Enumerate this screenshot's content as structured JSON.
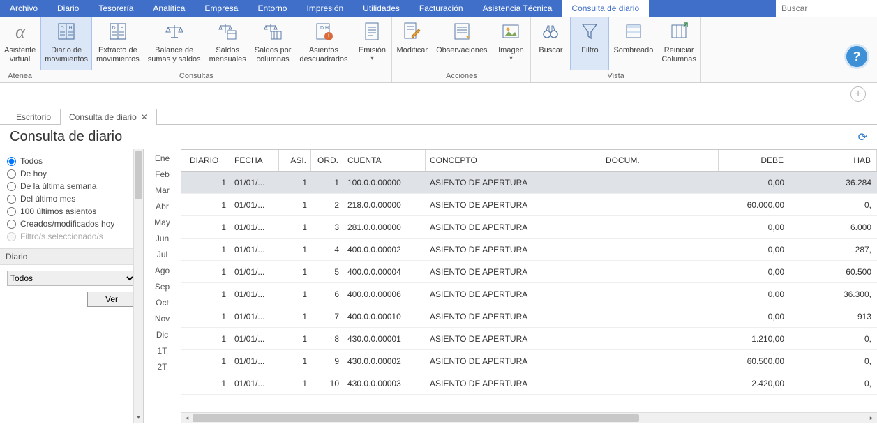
{
  "menu": [
    "Archivo",
    "Diario",
    "Tesorería",
    "Analítica",
    "Empresa",
    "Entorno",
    "Impresión",
    "Utilidades",
    "Facturación",
    "Asistencia Técnica",
    "Consulta de diario"
  ],
  "menu_active_index": 10,
  "search_placeholder": "Buscar",
  "ribbon_groups": [
    {
      "label": "Atenea",
      "buttons": [
        {
          "name": "asistente-virtual",
          "l1": "Asistente",
          "l2": "virtual",
          "icon": "alpha"
        }
      ]
    },
    {
      "label": "Consultas",
      "buttons": [
        {
          "name": "diario-movimientos",
          "l1": "Diario de",
          "l2": "movimientos",
          "icon": "doc-dh",
          "active": true
        },
        {
          "name": "extracto-movimientos",
          "l1": "Extracto de",
          "l2": "movimientos",
          "icon": "doc-dh"
        },
        {
          "name": "balance-sumas-saldos",
          "l1": "Balance de",
          "l2": "sumas y saldos",
          "icon": "scales"
        },
        {
          "name": "saldos-mensuales",
          "l1": "Saldos",
          "l2": "mensuales",
          "icon": "scales-cal"
        },
        {
          "name": "saldos-por-columnas",
          "l1": "Saldos por",
          "l2": "columnas",
          "icon": "scales-cols"
        },
        {
          "name": "asientos-descuadrados",
          "l1": "Asientos",
          "l2": "descuadrados",
          "icon": "doc-warn"
        }
      ]
    },
    {
      "label": "",
      "buttons": [
        {
          "name": "emision",
          "l1": "Emisión",
          "l2": "",
          "icon": "doc",
          "dropdown": true
        }
      ]
    },
    {
      "label": "Acciones",
      "buttons": [
        {
          "name": "modificar",
          "l1": "Modificar",
          "l2": "",
          "icon": "edit"
        },
        {
          "name": "observaciones",
          "l1": "Observaciones",
          "l2": "",
          "icon": "note"
        },
        {
          "name": "imagen",
          "l1": "Imagen",
          "l2": "",
          "icon": "image",
          "dropdown": true
        }
      ]
    },
    {
      "label": "Vista",
      "buttons": [
        {
          "name": "buscar",
          "l1": "Buscar",
          "l2": "",
          "icon": "binoc"
        },
        {
          "name": "filtro",
          "l1": "Filtro",
          "l2": "",
          "icon": "funnel",
          "active": true
        },
        {
          "name": "sombreado",
          "l1": "Sombreado",
          "l2": "",
          "icon": "shade"
        },
        {
          "name": "reiniciar-columnas",
          "l1": "Reiniciar",
          "l2": "Columnas",
          "icon": "columns"
        }
      ]
    }
  ],
  "tabs": [
    {
      "name": "escritorio",
      "label": "Escritorio",
      "active": false,
      "closable": false
    },
    {
      "name": "consulta-diario",
      "label": "Consulta de diario",
      "active": true,
      "closable": true
    }
  ],
  "page_title": "Consulta de diario",
  "filters": {
    "radios": [
      {
        "id": "todos",
        "label": "Todos",
        "checked": true
      },
      {
        "id": "de-hoy",
        "label": "De hoy"
      },
      {
        "id": "ultima-semana",
        "label": "De la última semana"
      },
      {
        "id": "ultimo-mes",
        "label": "Del último mes"
      },
      {
        "id": "cien-ultimos",
        "label": "100 últimos asientos"
      },
      {
        "id": "creados-hoy",
        "label": "Creados/modificados hoy"
      },
      {
        "id": "filtros-sel",
        "label": "Filtro/s seleccionado/s",
        "disabled": true
      }
    ],
    "section_label": "Diario",
    "combo_value": "Todos",
    "ver_label": "Ver"
  },
  "months": [
    "Ene",
    "Feb",
    "Mar",
    "Abr",
    "May",
    "Jun",
    "Jul",
    "Ago",
    "Sep",
    "Oct",
    "Nov",
    "Dic",
    "1T",
    "2T"
  ],
  "columns": [
    {
      "key": "diario",
      "label": "DIARIO"
    },
    {
      "key": "fecha",
      "label": "FECHA"
    },
    {
      "key": "asi",
      "label": "ASI."
    },
    {
      "key": "ord",
      "label": "ORD."
    },
    {
      "key": "cuenta",
      "label": "CUENTA"
    },
    {
      "key": "concepto",
      "label": "CONCEPTO"
    },
    {
      "key": "docum",
      "label": "DOCUM."
    },
    {
      "key": "debe",
      "label": "DEBE"
    },
    {
      "key": "hab",
      "label": "HAB"
    }
  ],
  "rows": [
    {
      "diario": "1",
      "fecha": "01/01/...",
      "asi": "1",
      "ord": "1",
      "cuenta": "100.0.0.00000",
      "concepto": "ASIENTO DE APERTURA",
      "docum": "",
      "debe": "0,00",
      "hab": "36.284",
      "sel": true
    },
    {
      "diario": "1",
      "fecha": "01/01/...",
      "asi": "1",
      "ord": "2",
      "cuenta": "218.0.0.00000",
      "concepto": "ASIENTO DE APERTURA",
      "docum": "",
      "debe": "60.000,00",
      "hab": "0,"
    },
    {
      "diario": "1",
      "fecha": "01/01/...",
      "asi": "1",
      "ord": "3",
      "cuenta": "281.0.0.00000",
      "concepto": "ASIENTO DE APERTURA",
      "docum": "",
      "debe": "0,00",
      "hab": "6.000"
    },
    {
      "diario": "1",
      "fecha": "01/01/...",
      "asi": "1",
      "ord": "4",
      "cuenta": "400.0.0.00002",
      "concepto": "ASIENTO DE APERTURA",
      "docum": "",
      "debe": "0,00",
      "hab": "287,"
    },
    {
      "diario": "1",
      "fecha": "01/01/...",
      "asi": "1",
      "ord": "5",
      "cuenta": "400.0.0.00004",
      "concepto": "ASIENTO DE APERTURA",
      "docum": "",
      "debe": "0,00",
      "hab": "60.500"
    },
    {
      "diario": "1",
      "fecha": "01/01/...",
      "asi": "1",
      "ord": "6",
      "cuenta": "400.0.0.00006",
      "concepto": "ASIENTO DE APERTURA",
      "docum": "",
      "debe": "0,00",
      "hab": "36.300,"
    },
    {
      "diario": "1",
      "fecha": "01/01/...",
      "asi": "1",
      "ord": "7",
      "cuenta": "400.0.0.00010",
      "concepto": "ASIENTO DE APERTURA",
      "docum": "",
      "debe": "0,00",
      "hab": "913"
    },
    {
      "diario": "1",
      "fecha": "01/01/...",
      "asi": "1",
      "ord": "8",
      "cuenta": "430.0.0.00001",
      "concepto": "ASIENTO DE APERTURA",
      "docum": "",
      "debe": "1.210,00",
      "hab": "0,"
    },
    {
      "diario": "1",
      "fecha": "01/01/...",
      "asi": "1",
      "ord": "9",
      "cuenta": "430.0.0.00002",
      "concepto": "ASIENTO DE APERTURA",
      "docum": "",
      "debe": "60.500,00",
      "hab": "0,"
    },
    {
      "diario": "1",
      "fecha": "01/01/...",
      "asi": "1",
      "ord": "10",
      "cuenta": "430.0.0.00003",
      "concepto": "ASIENTO DE APERTURA",
      "docum": "",
      "debe": "2.420,00",
      "hab": "0,"
    }
  ]
}
